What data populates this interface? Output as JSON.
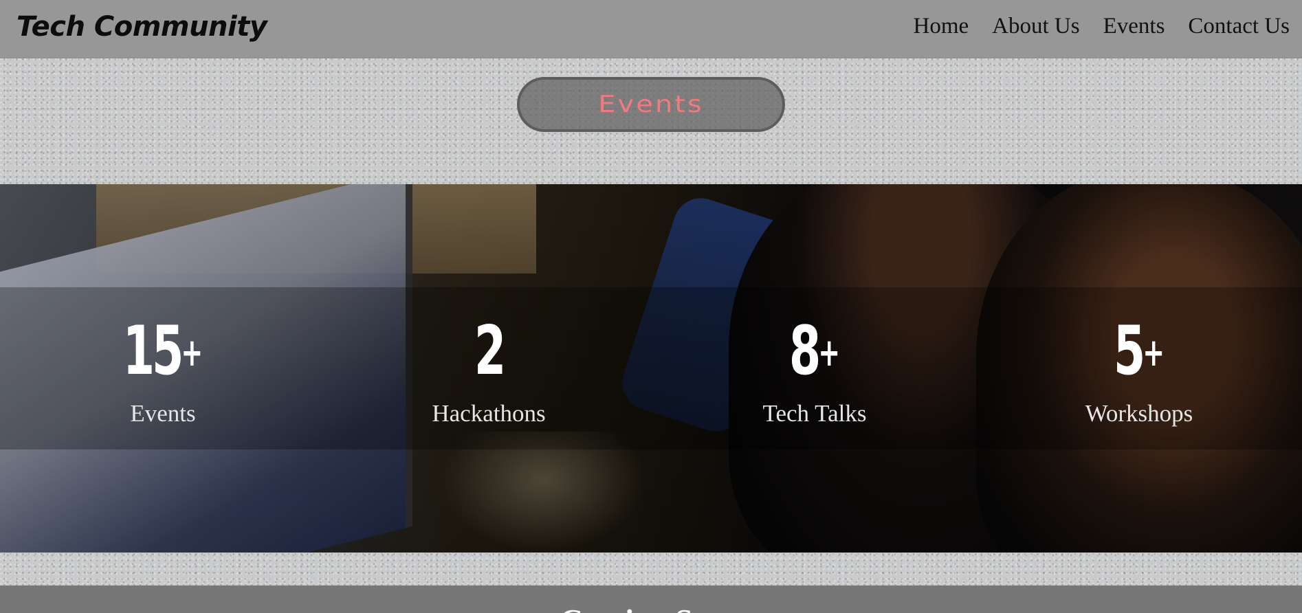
{
  "header": {
    "brand": "Tech Community",
    "nav": [
      "Home",
      "About Us",
      "Events",
      "Contact Us"
    ]
  },
  "section_pill": {
    "label": "Events"
  },
  "stats": [
    {
      "number": "15",
      "suffix": "+",
      "label": "Events"
    },
    {
      "number": "2",
      "suffix": "",
      "label": "Hackathons"
    },
    {
      "number": "8",
      "suffix": "+",
      "label": "Tech Talks"
    },
    {
      "number": "5",
      "suffix": "+",
      "label": "Workshops"
    }
  ],
  "colors": {
    "header_bg": "#979797",
    "pill_text": "#f07a80",
    "stat_text": "#ffffff"
  },
  "bottom": {
    "heading": "Coming Soon"
  }
}
